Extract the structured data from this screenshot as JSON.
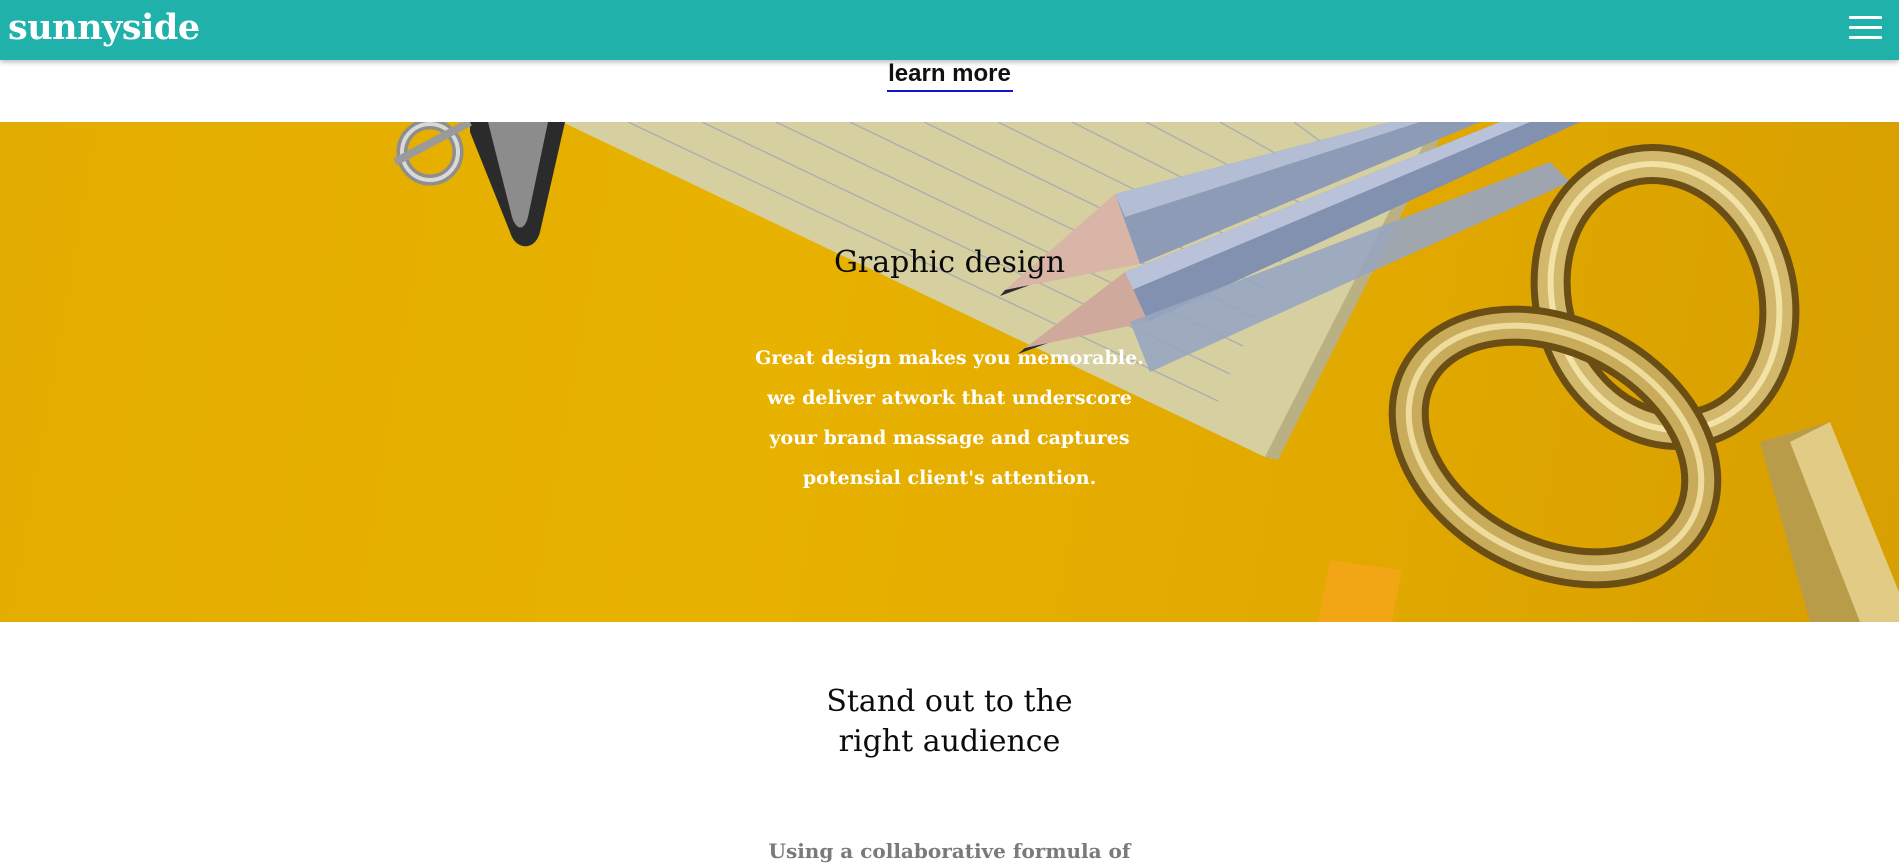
{
  "navbar": {
    "logo": "sunnyside",
    "menu_icon": "hamburger-menu-icon",
    "background_color": "#20b1ab"
  },
  "learn_more": {
    "label": "learn more",
    "underline_color": "#1515c8"
  },
  "graphic_design": {
    "title": "Graphic design",
    "lines": [
      "Great design makes you memorable.",
      "we deliver atwork that underscore",
      "your brand massage and captures",
      "potensial client's attention."
    ],
    "background_color": "#e3ac00"
  },
  "standout": {
    "title_lines": [
      "Stand out to the",
      "right audience"
    ],
    "text": "Using a collaborative formula of"
  }
}
